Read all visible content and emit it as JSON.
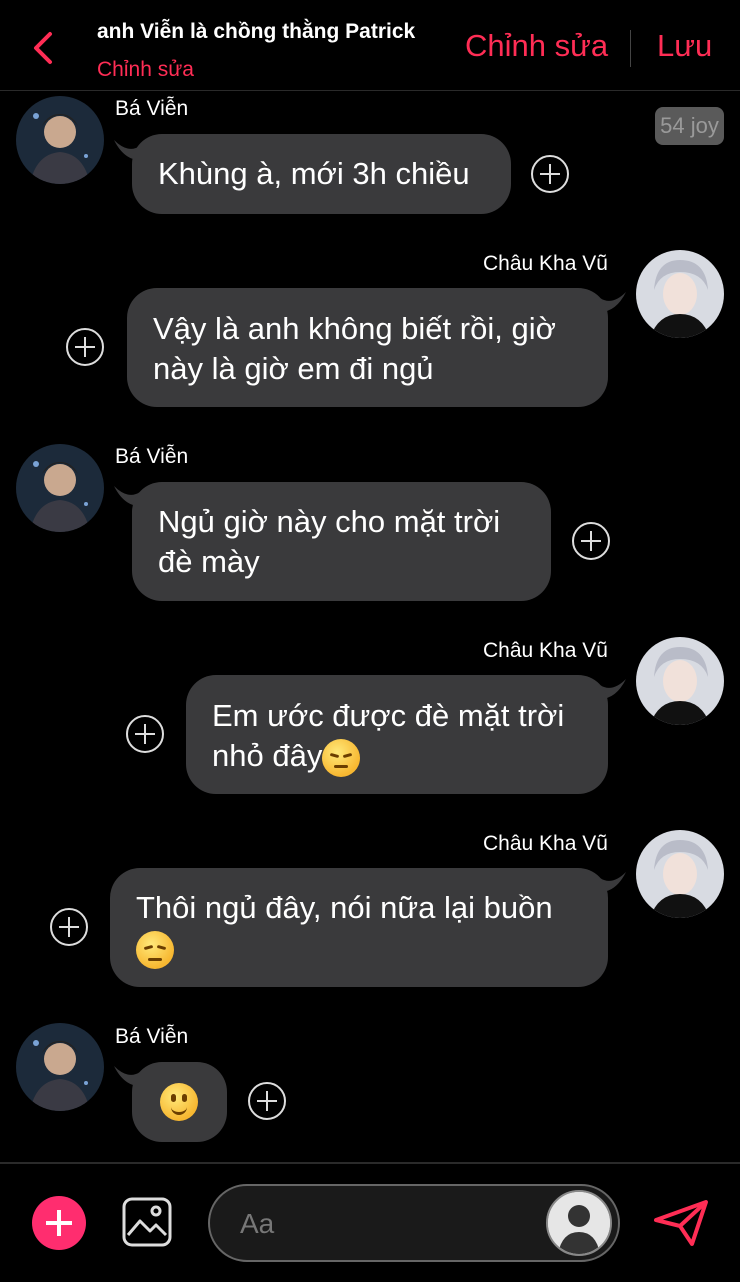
{
  "header": {
    "title": "anh Viễn là chồng thằng Patrick",
    "subtitle": "Chỉnh sửa",
    "edit_label": "Chỉnh sửa",
    "save_label": "Lưu"
  },
  "badge": "54 joy",
  "messages": [
    {
      "sender": "Bá Viễn",
      "side": "left",
      "text": "Khùng à, mới 3h chiều"
    },
    {
      "sender": "Châu Kha Vũ",
      "side": "right",
      "line1": "Vậy là anh không biết rồi, giờ",
      "line2": "này là giờ em đi ngủ"
    },
    {
      "sender": "Bá Viễn",
      "side": "left",
      "line1": "Ngủ giờ này cho mặt trời",
      "line2": "đè mày"
    },
    {
      "sender": "Châu Kha Vũ",
      "side": "right",
      "line1": "Em ước được đè mặt trời",
      "line2": "nhỏ đây",
      "emoji": "pensive-face"
    },
    {
      "sender": "Châu Kha Vũ",
      "side": "right",
      "line1": "Thôi ngủ đây, nói nữa lại buồn",
      "emoji": "disappointed-face"
    },
    {
      "sender": "Bá Viễn",
      "side": "left",
      "emoji": "slightly-smiling-face"
    }
  ],
  "composer": {
    "placeholder": "Aa"
  },
  "colors": {
    "accent": "#ff2d55",
    "bubble": "#3a3a3c",
    "background": "#000000"
  }
}
